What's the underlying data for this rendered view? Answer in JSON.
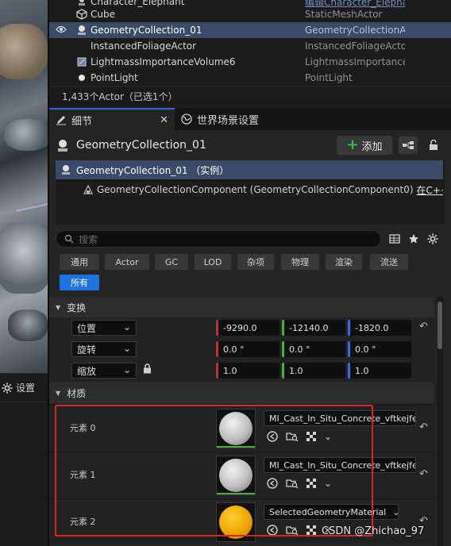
{
  "outliner": {
    "rows": [
      {
        "name": "Character_Elephant",
        "type": "编辑Character_Elephant",
        "icon": "actor-icon",
        "selected": false
      },
      {
        "name": "Cube",
        "type": "StaticMeshActor",
        "icon": "cube-icon",
        "selected": false
      },
      {
        "name": "GeometryCollection_01",
        "type": "GeometryCollectionAc",
        "icon": "geometry-collection-icon",
        "selected": true
      },
      {
        "name": "InstancedFoliageActor",
        "type": "InstancedFoliageActo",
        "icon": "actor-icon",
        "selected": false
      },
      {
        "name": "LightmassImportanceVolume6",
        "type": "LightmassImportance",
        "icon": "volume-icon",
        "selected": false
      },
      {
        "name": "PointLight",
        "type": "PointLight",
        "icon": "point-light-icon",
        "selected": false
      }
    ],
    "actor_count": "1,433个Actor（已选1个）"
  },
  "left": {
    "settings_label": "设置"
  },
  "tabs": {
    "details": "细节",
    "world_settings": "世界场景设置"
  },
  "details": {
    "actor_name": "GeometryCollection_01",
    "add_label": "添加",
    "component_root": "GeometryCollection_01 （实例）",
    "component_child": "GeometryCollectionComponent (GeometryCollectionComponent0)",
    "component_child_link": "在C++中编",
    "search_placeholder": "搜索"
  },
  "filters": [
    "通用",
    "Actor",
    "GC",
    "LOD",
    "杂项",
    "物理",
    "渲染",
    "流送",
    "所有"
  ],
  "active_filter": "所有",
  "transform": {
    "category": "变换",
    "rows": [
      {
        "label": "位置",
        "x": "-9290.0",
        "y": "-12140.0",
        "z": "-1820.0"
      },
      {
        "label": "旋转",
        "x": "0.0 °",
        "y": "0.0 °",
        "z": "0.0 °"
      },
      {
        "label": "缩放",
        "x": "1.0",
        "y": "1.0",
        "z": "1.0"
      }
    ]
  },
  "materials": {
    "category": "材质",
    "elements": [
      {
        "label": "元素 0",
        "material": "MI_Cast_In_Situ_Concrete_vftkejfew_",
        "preview": "white"
      },
      {
        "label": "元素 1",
        "material": "MI_Cast_In_Situ_Concrete_vftkejfew_",
        "preview": "white"
      },
      {
        "label": "元素 2",
        "material": "SelectedGeometryMaterial",
        "preview": "orange"
      }
    ]
  },
  "watermark": "CSDN @Zhichao_97",
  "colors": {
    "selection": "#394b66",
    "accent_blue": "#1d73e0",
    "axis_x": "#c23131",
    "axis_y": "#4cae3a",
    "axis_z": "#2e6ef0",
    "highlight_box": "#d62626"
  }
}
